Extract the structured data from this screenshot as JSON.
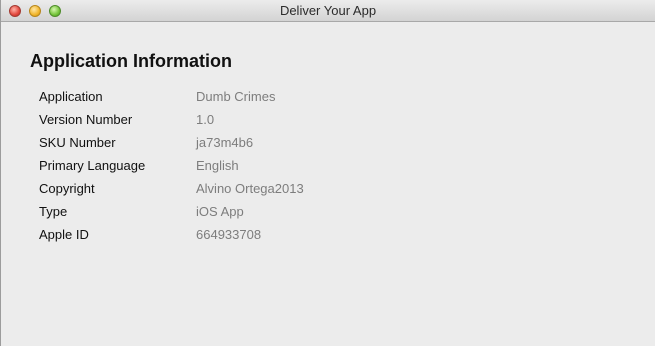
{
  "window": {
    "title": "Deliver Your App"
  },
  "section": {
    "title": "Application Information"
  },
  "info_rows": [
    {
      "label": "Application",
      "value": "Dumb Crimes"
    },
    {
      "label": "Version Number",
      "value": "1.0"
    },
    {
      "label": "SKU Number",
      "value": "ja73m4b6"
    },
    {
      "label": "Primary Language",
      "value": "English"
    },
    {
      "label": "Copyright",
      "value": "Alvino Ortega2013"
    },
    {
      "label": "Type",
      "value": "iOS App"
    },
    {
      "label": "Apple ID",
      "value": "664933708"
    }
  ]
}
